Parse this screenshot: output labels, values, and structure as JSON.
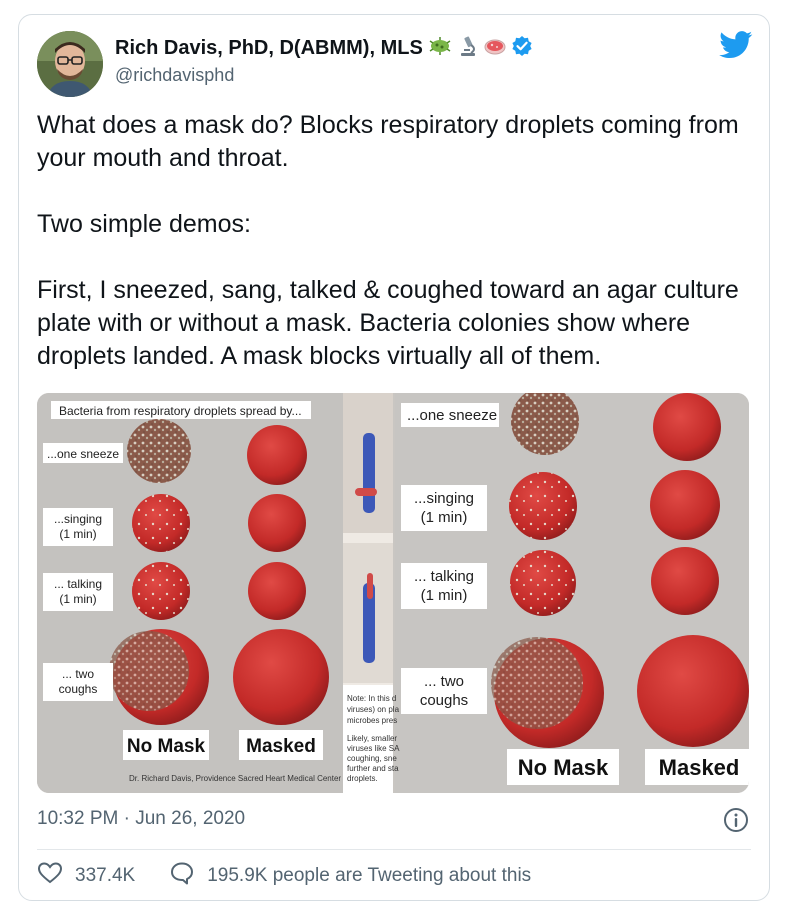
{
  "tweet": {
    "author_name": "Rich Davis, PhD, D(ABMM), MLS",
    "handle": "@richdavisphd",
    "paragraphs": [
      "What does a mask do? Blocks respiratory droplets coming from your mouth and throat.",
      "Two simple demos:",
      "First, I sneezed, sang, talked & coughed toward an agar culture plate with or without a mask. Bacteria colonies show where droplets landed. A mask blocks virtually all of them."
    ],
    "timestamp": "10:32 PM · Jun 26, 2020",
    "likes": "337.4K",
    "tweeting_about": "195.9K people are Tweeting about this"
  },
  "media": {
    "left_header": "Bacteria from respiratory droplets spread by...",
    "left_rows": [
      "...one sneeze",
      "...singing\n(1 min)",
      "... talking\n(1 min)",
      "... two\ncoughs"
    ],
    "left_no_mask": "No Mask",
    "left_masked": "Masked",
    "credit": "Dr. Richard Davis, Providence Sacred Heart Medical Center",
    "note_1": "Note: In this d\nviruses) on pla\nmicrobes pres",
    "note_2": "Likely, smaller\nviruses like SA\ncoughing, sne\nfurther and sta\ndroplets.",
    "right_rows": [
      "...one sneeze",
      "...singing\n(1 min)",
      "... talking\n(1 min)",
      "... two\ncoughs"
    ],
    "right_no_mask": "No Mask",
    "right_masked": "Masked"
  },
  "colors": {
    "twitter_blue": "#1d9bf0",
    "text": "#0f1419",
    "muted": "#536471",
    "agar_red": "#c8312f"
  },
  "icons": {
    "name_badges": [
      "microbe-icon",
      "microscope-icon",
      "petri-dish-icon",
      "verified-badge-icon"
    ],
    "brand": "twitter-bird-icon",
    "info": "info-icon",
    "like": "heart-icon",
    "reply": "speech-bubble-icon"
  }
}
